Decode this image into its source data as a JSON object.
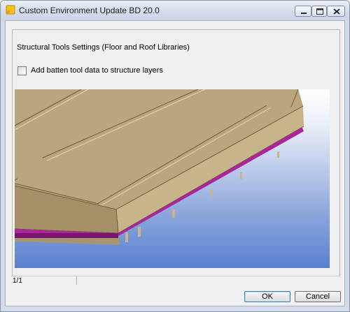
{
  "window": {
    "title": "Custom Environment Update BD 20.0",
    "controls": [
      "minimize",
      "maximize",
      "close"
    ]
  },
  "content": {
    "heading": "Structural Tools Settings (Floor and Roof Libraries)",
    "checkbox": {
      "label": "Add batten tool data to structure layers",
      "checked": false
    },
    "preview": {
      "description_icon": "floor-structure-3d-preview"
    }
  },
  "statusbar": {
    "page": "1/1"
  },
  "buttons": {
    "ok": "OK",
    "cancel": "Cancel"
  },
  "colors": {
    "batten_magenta": "#b0229e",
    "board_tan": "#b9a67e",
    "preview_sky_top": "#ffffff",
    "preview_sky_bottom": "#5a80cf"
  }
}
